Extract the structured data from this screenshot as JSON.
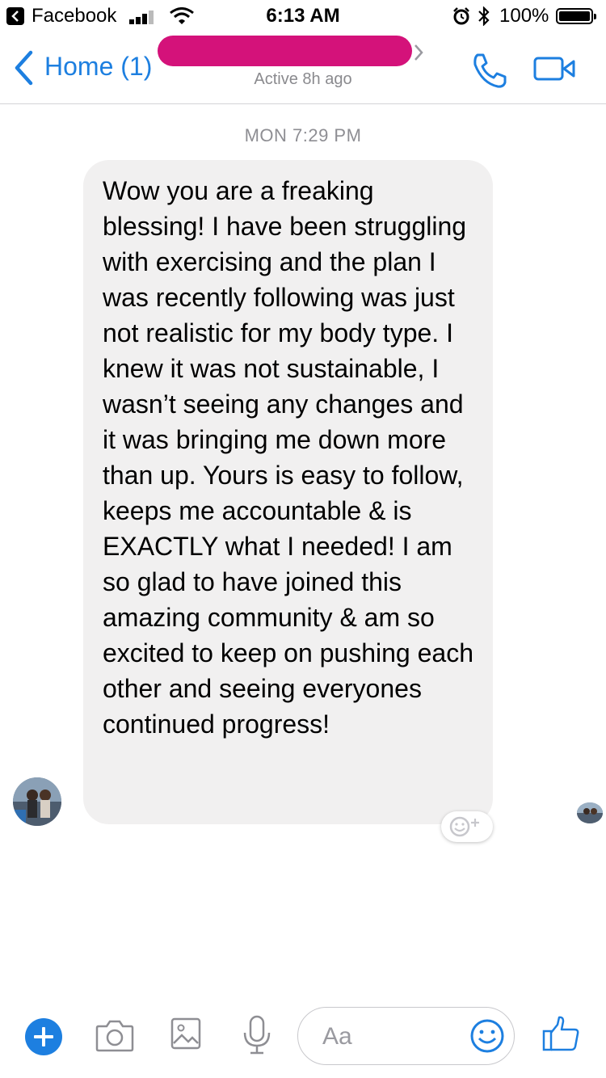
{
  "status_bar": {
    "back_app": "Facebook",
    "time": "6:13 AM",
    "battery": "100%"
  },
  "nav": {
    "back_label": "Home (1)",
    "subtitle": "Active 8h ago",
    "name_redaction_color": "#d4127a"
  },
  "thread": {
    "timestamp": "MON 7:29 PM",
    "message": "Wow you are a freaking blessing! I have been struggling with exercising and the plan I was recently following was just not realistic for my body type. I knew it was not sustainable, I wasn’t seeing any changes and it was bringing me down more than up. Yours is easy to follow, keeps me accountable & is EXACTLY what I needed! I am so glad to have joined this amazing community & am so excited to keep on pushing each other and seeing everyones continued progress!"
  },
  "composer": {
    "placeholder": "Aa"
  },
  "colors": {
    "accent": "#1d7fe0",
    "bubble": "#f1f0f0",
    "muted_text": "#8e8e93"
  },
  "icons": [
    "facebook-back-icon",
    "signal-icon",
    "wifi-icon",
    "alarm-icon",
    "bluetooth-icon",
    "battery-icon",
    "back-chevron-icon",
    "phone-icon",
    "video-icon",
    "add-reaction-icon",
    "plus-icon",
    "camera-icon",
    "image-icon",
    "microphone-icon",
    "emoji-icon",
    "thumbs-up-icon"
  ]
}
